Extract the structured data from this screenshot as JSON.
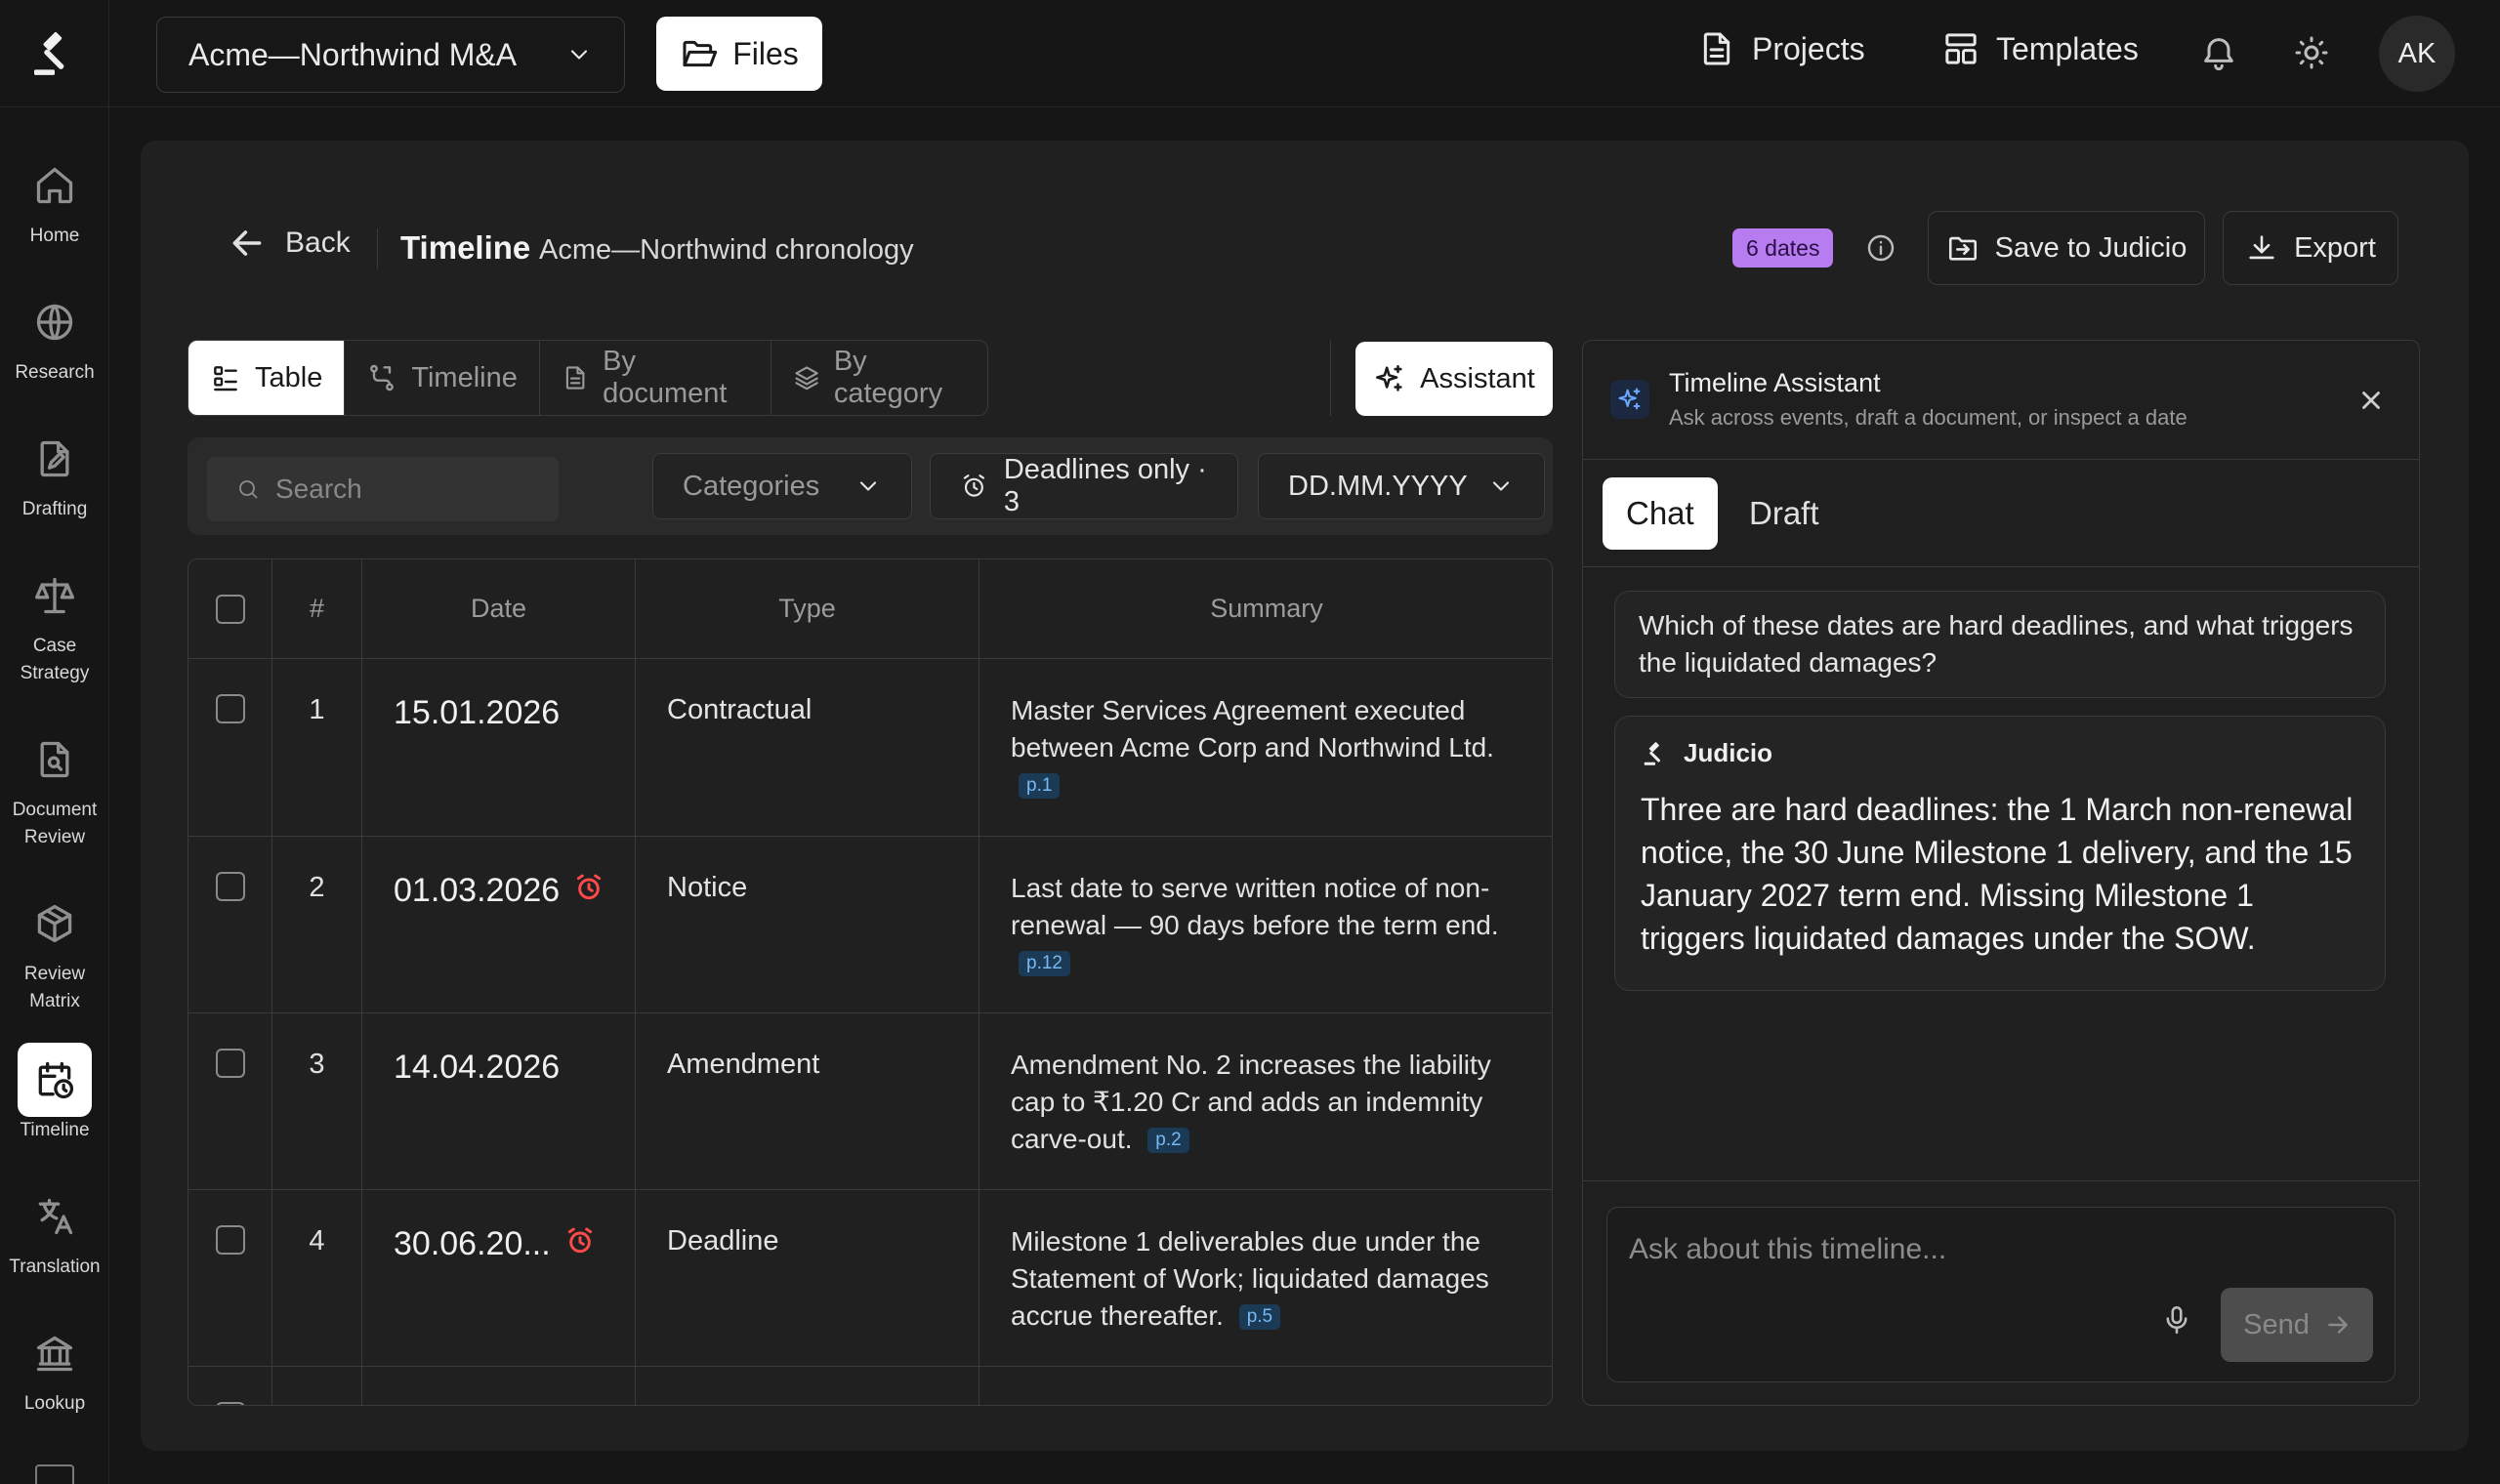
{
  "sidebar": {
    "items": [
      {
        "label": "Home",
        "icon": "home-icon"
      },
      {
        "label": "Research",
        "icon": "globe-icon"
      },
      {
        "label": "Drafting",
        "icon": "document-pen-icon"
      },
      {
        "label": "Case Strategy",
        "icon": "scales-icon"
      },
      {
        "label": "Document Review",
        "icon": "document-search-icon"
      },
      {
        "label": "Review Matrix",
        "icon": "cube-icon"
      },
      {
        "label": "Timeline",
        "icon": "calendar-clock-icon",
        "active": true
      },
      {
        "label": "Translation",
        "icon": "translate-icon"
      },
      {
        "label": "Lookup",
        "icon": "bank-icon"
      }
    ]
  },
  "topbar": {
    "project": "Acme—Northwind M&A",
    "files_label": "Files",
    "projects_label": "Projects",
    "templates_label": "Templates",
    "avatar_initials": "AK"
  },
  "header": {
    "back_label": "Back",
    "title": "Timeline",
    "subtitle": "Acme—Northwind chronology",
    "dates_badge": "6 dates",
    "save_label": "Save to Judicio",
    "export_label": "Export"
  },
  "view_tabs": {
    "table": "Table",
    "timeline": "Timeline",
    "by_document": "By document",
    "by_category": "By category"
  },
  "assistant_button": "Assistant",
  "filters": {
    "search_placeholder": "Search",
    "categories": "Categories",
    "deadlines": "Deadlines only · 3",
    "date_format": "DD.MM.YYYY"
  },
  "table": {
    "columns": {
      "num": "#",
      "date": "Date",
      "type": "Type",
      "summary": "Summary"
    },
    "rows": [
      {
        "num": "1",
        "date": "15.01.2026",
        "deadline": false,
        "type": "Contractual",
        "summary": "Master Services Agreement executed between Acme Corp and Northwind Ltd.",
        "page": "p.1"
      },
      {
        "num": "2",
        "date": "01.03.2026",
        "deadline": true,
        "type": "Notice",
        "summary": "Last date to serve written notice of non-renewal — 90 days before the term end.",
        "page": "p.12"
      },
      {
        "num": "3",
        "date": "14.04.2026",
        "deadline": false,
        "type": "Amendment",
        "summary": "Amendment No. 2 increases the liability cap to ₹1.20 Cr and adds an indemnity carve-out.",
        "page": "p.2"
      },
      {
        "num": "4",
        "date": "30.06.20...",
        "deadline": true,
        "type": "Deadline",
        "summary": "Milestone 1 deliverables due under the Statement of Work; liquidated damages accrue thereafter.",
        "page": "p.5"
      }
    ]
  },
  "assistant": {
    "title": "Timeline Assistant",
    "subtitle": "Ask across events, draft a document, or inspect a date",
    "tabs": {
      "chat": "Chat",
      "draft": "Draft"
    },
    "user_message": "Which of these dates are hard deadlines, and what triggers the liquidated damages?",
    "bot_name": "Judicio",
    "bot_message": "Three are hard deadlines: the 1 March non-renewal notice, the 30 June Milestone 1 delivery, and the 15 January 2027 term end. Missing Milestone 1 triggers liquidated damages under the SOW.",
    "composer_placeholder": "Ask about this timeline...",
    "send_label": "Send"
  },
  "colors": {
    "accent_purple": "#b77cf0",
    "deadline_red": "#ff4a4a",
    "page_ref_blue": "#79b8f2"
  }
}
